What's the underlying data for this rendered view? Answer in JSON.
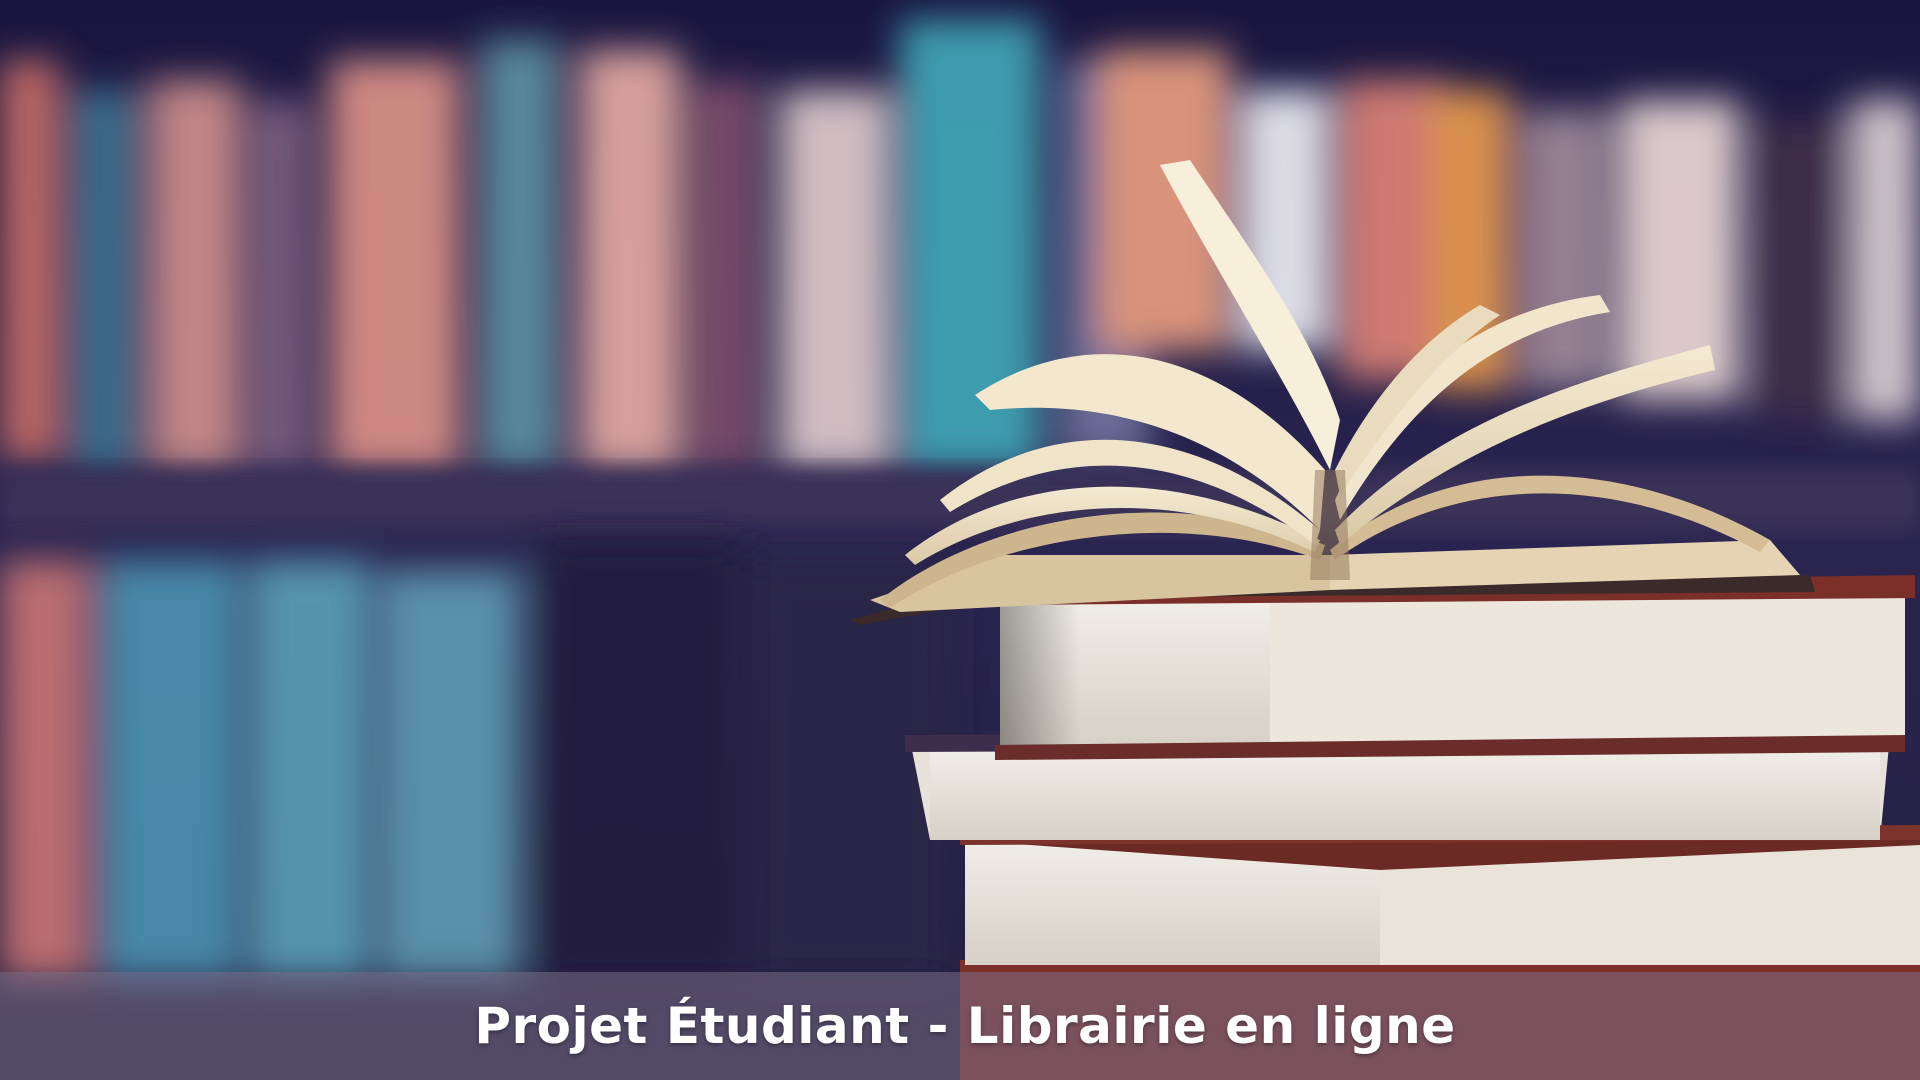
{
  "hero": {
    "caption": "Projet Étudiant - Librairie en ligne"
  },
  "colors": {
    "background_dark": "#1c1838",
    "caption_band": "#786e87",
    "caption_text": "#ffffff"
  }
}
